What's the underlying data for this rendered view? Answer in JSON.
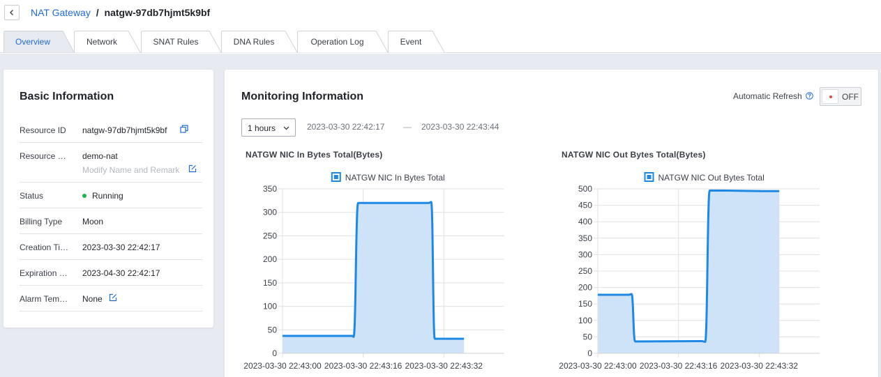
{
  "breadcrumb": {
    "parent": "NAT Gateway",
    "separator": "/",
    "current": "natgw-97db7hjmt5k9bf"
  },
  "tabs": [
    {
      "label": "Overview",
      "active": true
    },
    {
      "label": "Network",
      "active": false
    },
    {
      "label": "SNAT Rules",
      "active": false
    },
    {
      "label": "DNA Rules",
      "active": false
    },
    {
      "label": "Operation Log",
      "active": false
    },
    {
      "label": "Event",
      "active": false
    }
  ],
  "basic": {
    "title": "Basic Information",
    "rows": {
      "resource_id": {
        "label": "Resource ID",
        "value": "natgw-97db7hjmt5k9bf",
        "icon": "copy-icon"
      },
      "resource_name": {
        "label": "Resource …",
        "value": "demo-nat",
        "sub": "Modify Name and Remark",
        "icon": "edit-icon"
      },
      "status": {
        "label": "Status",
        "value": "Running",
        "color": "#1db54a"
      },
      "billing": {
        "label": "Billing Type",
        "value": "Moon"
      },
      "creation": {
        "label": "Creation Ti…",
        "value": "2023-03-30 22:42:17"
      },
      "expiration": {
        "label": "Expiration …",
        "value": "2023-04-30 22:42:17"
      },
      "alarm": {
        "label": "Alarm Tem…",
        "value": "None",
        "icon": "edit-icon"
      }
    }
  },
  "monitor": {
    "title": "Monitoring Information",
    "auto_refresh_label": "Automatic Refresh",
    "toggle_state": "OFF",
    "range_select": "1 hours",
    "time_start": "2023-03-30 22:42:17",
    "time_separator": "—",
    "time_end": "2023-03-30 22:43:44"
  },
  "colors": {
    "accent": "#1f6ad8",
    "line": "#1e88e5",
    "fill": "#cfe3f8",
    "running": "#1db54a"
  },
  "chart_data": [
    {
      "type": "area",
      "title": "NATGW NIC In Bytes Total(Bytes)",
      "legend": "NATGW NIC In Bytes Total",
      "x_ticks": [
        "2023-03-30 22:43:00",
        "2023-03-30 22:43:16",
        "2023-03-30 22:43:32"
      ],
      "y_ticks": [
        0,
        50,
        100,
        150,
        200,
        250,
        300,
        350
      ],
      "ylim": [
        0,
        350
      ],
      "xlim": [
        0,
        44
      ],
      "tick_x": [
        0,
        16,
        32
      ],
      "series": [
        {
          "name": "NATGW NIC In Bytes Total",
          "x": [
            -8,
            13.8,
            14.1,
            15.0,
            29.0,
            29.5,
            30.2,
            36
          ],
          "y": [
            37,
            37,
            35,
            320,
            320,
            322,
            31,
            31
          ]
        }
      ],
      "grid": true,
      "legend_position": "top"
    },
    {
      "type": "area",
      "title": "NATGW NIC Out Bytes Total(Bytes)",
      "legend": "NATGW NIC Out Bytes Total",
      "x_ticks": [
        "2023-03-30 22:43:00",
        "2023-03-30 22:43:16",
        "2023-03-30 22:43:32"
      ],
      "y_ticks": [
        0,
        50,
        100,
        150,
        200,
        250,
        300,
        350,
        400,
        450,
        500
      ],
      "ylim": [
        0,
        500
      ],
      "xlim": [
        0,
        44
      ],
      "tick_x": [
        0,
        16,
        32
      ],
      "series": [
        {
          "name": "NATGW NIC Out Bytes Total",
          "x": [
            -8,
            6.2,
            6.7,
            7.4,
            20.6,
            21.3,
            22.2,
            36
          ],
          "y": [
            178,
            178,
            180,
            36,
            37,
            35,
            495,
            493
          ]
        }
      ],
      "grid": true,
      "legend_position": "top"
    }
  ]
}
